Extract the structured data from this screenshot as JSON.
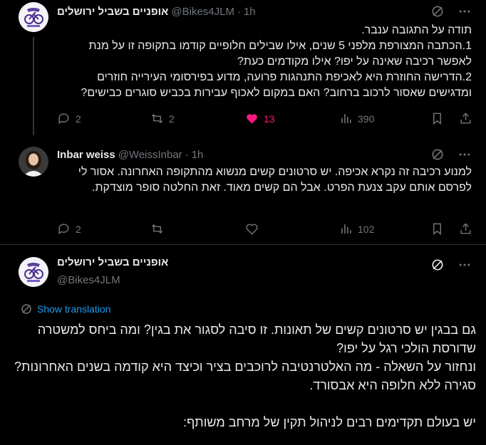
{
  "tweets": [
    {
      "name": "אופניים בשביל ירושלים",
      "handle": "@Bikes4JLM",
      "time": "1h",
      "text": "תודה על התגובה ענבר.\n1.הכתבה המצורפת מלפני 5 שנים, אילו שבילים חלופיים קודמו בתקופה זו על מנת לאפשר רכיבה שאינה על יפו? אילו מקודמים כעת?\n2.הדרישה החוזרת היא לאכיפת התנהגות פרועה, מדוע בפירסומי העירייה חוזרים ומדגישים שאסור לרכוב ברחוב? האם במקום לאכוף עבירות בכביש סוגרים כבישים?",
      "replies": "2",
      "reposts": "2",
      "likes": "13",
      "views": "390"
    },
    {
      "name": "Inbar weiss",
      "handle": "@WeissInbar",
      "time": "1h",
      "text": "למנוע רכיבה זה נקרא אכיפה. יש סרטונים קשים מנשוא מהתקופה האחרונה. אסור לי לפרסם אותם עקב צנעת הפרט. אבל הם קשים מאוד. זאת החלטה סופר מוצדקת.",
      "replies": "2",
      "views": "102"
    }
  ],
  "main_tweet": {
    "name": "אופניים בשביל ירושלים",
    "handle": "@Bikes4JLM",
    "show_translation": "Show translation",
    "text": "גם בבגין יש סרטונים קשים של תאונות. זו סיבה לסגור את בגין? ומה ביחס למשטרה שדורסת הולכי רגל על יפו?\nונחזור על השאלה - מה האלטרנטיבה לרוכבים בציר וכיצד היא קודמה בשנים האחרונות? סגירה ללא חלופה היא אבסורד.\n\nיש בעולם תקדימים רבים לניהול תקין של מרחב משותף:"
  },
  "colors": {
    "like": "#f91880",
    "link": "#1d9bf0",
    "muted": "#71767b"
  },
  "icons": [
    "grok-icon",
    "more-icon",
    "reply-icon",
    "repost-icon",
    "like-icon",
    "views-icon",
    "bookmark-icon",
    "share-icon",
    "translate-icon"
  ]
}
